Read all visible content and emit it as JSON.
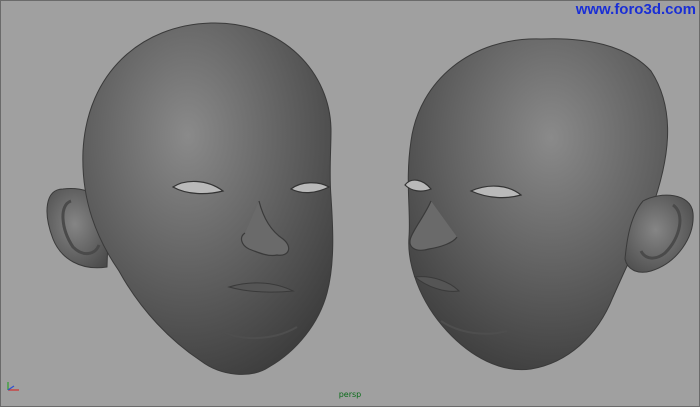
{
  "watermark": {
    "text": "www.foro3d.com"
  },
  "viewport": {
    "camera_label": "persp",
    "background_color": "#a0a0a0",
    "camera_label_color": "#0b6b1a"
  },
  "scene": {
    "objects": [
      {
        "name": "head-model-left",
        "view": "three-quarter facing right"
      },
      {
        "name": "head-model-right",
        "view": "three-quarter facing left"
      }
    ],
    "axis_icon": "view-axis-indicator-icon"
  }
}
